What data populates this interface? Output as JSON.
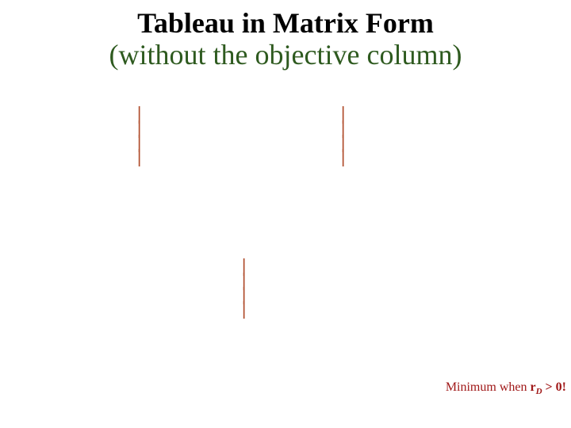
{
  "title": {
    "line1": "Tableau in Matrix Form",
    "line2": "(without the objective column)"
  },
  "decor": {
    "dash": "|",
    "dash_count": 4
  },
  "footer": {
    "prefix": "Minimum when ",
    "var": "r",
    "sub": "D",
    "suffix": " > 0!"
  }
}
